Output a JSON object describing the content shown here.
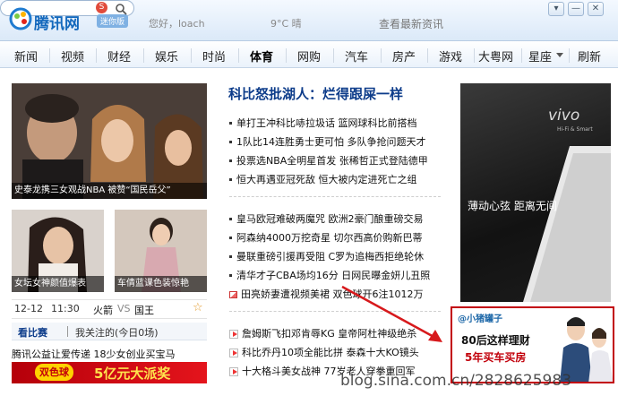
{
  "header": {
    "logo_text": "腾讯网",
    "badge": "迷你版",
    "greeting": "您好，loach",
    "weather": "9°C 晴",
    "latest_news": "查看最新资讯",
    "window_buttons": [
      "▾",
      "—",
      "✕"
    ],
    "search_placeholder": ""
  },
  "nav": {
    "items": [
      "新闻",
      "视频",
      "财经",
      "娱乐",
      "时尚",
      "体育",
      "网购",
      "汽车",
      "房产",
      "游戏",
      "大粤网",
      "星座",
      "刷新"
    ],
    "active": "体育"
  },
  "headline": "科比怒批湖人：烂得跟屎一样",
  "news_group1": [
    "单打王冲科比哧拉圾话 篮网球科比前搭档",
    "1队比14连胜勇士更可怕 多队争抢问题天才",
    "投票选NBA全明星首发 张稀哲正式登陆德甲",
    "恒大再遇亚冠死敌 恒大被内定进死亡之组"
  ],
  "news_group2": [
    "皇马欧冠难破两魔咒 欧洲2豪门酿重磅交易",
    "阿森纳4000万挖奇星 切尔西高价购新巴蒂",
    "曼联重磅引援再受阻 C罗为追梅西拒绝轮休",
    "清华才子CBA场均16分 日网民曝金妍儿丑照",
    "田亮娇妻遭视频美裙 双色球开6注1012万"
  ],
  "news_group3": [
    "詹姆斯飞扣邓肯辱KG 皇帝阿杜神级绝杀",
    "科比乔丹10项全能比拼 泰森十大KO镜头",
    "十大格斗美女战神 77岁老人穿拳重回军"
  ],
  "photos": {
    "main_caption": "史泰龙携三女观战NBA 被赞“国民岳父”",
    "small1_caption": "女坛女神颜值爆表",
    "small2_caption": "车倩蓝课色装惊艳"
  },
  "schedule": {
    "date": "12-12",
    "time": "11:30",
    "team1": "火箭",
    "vs": "VS",
    "team2": "国王",
    "star": "☆",
    "tab_active": "看比赛",
    "tab_other": "我关注的(今日0场)"
  },
  "bottom_items": [
    "腾讯公益让爱传递 18少女创业买宝马"
  ],
  "lottery": {
    "name": "双色球",
    "slogan": "5亿元大派奖"
  },
  "ad_vivo": {
    "brand": "vivo",
    "sub": "Hi-Fi & Smart",
    "slogan": "薄动心弦 距离无间"
  },
  "ad_pig": {
    "brand": "@小猪罐子",
    "line1": "80后这样理财",
    "line2": "5年买车买房"
  },
  "watermark": "blog.sina.com.cn/2828625983",
  "colors": {
    "brand_blue": "#1469bd",
    "accent_red": "#c2000b",
    "headline_blue": "#0d3c8a"
  }
}
